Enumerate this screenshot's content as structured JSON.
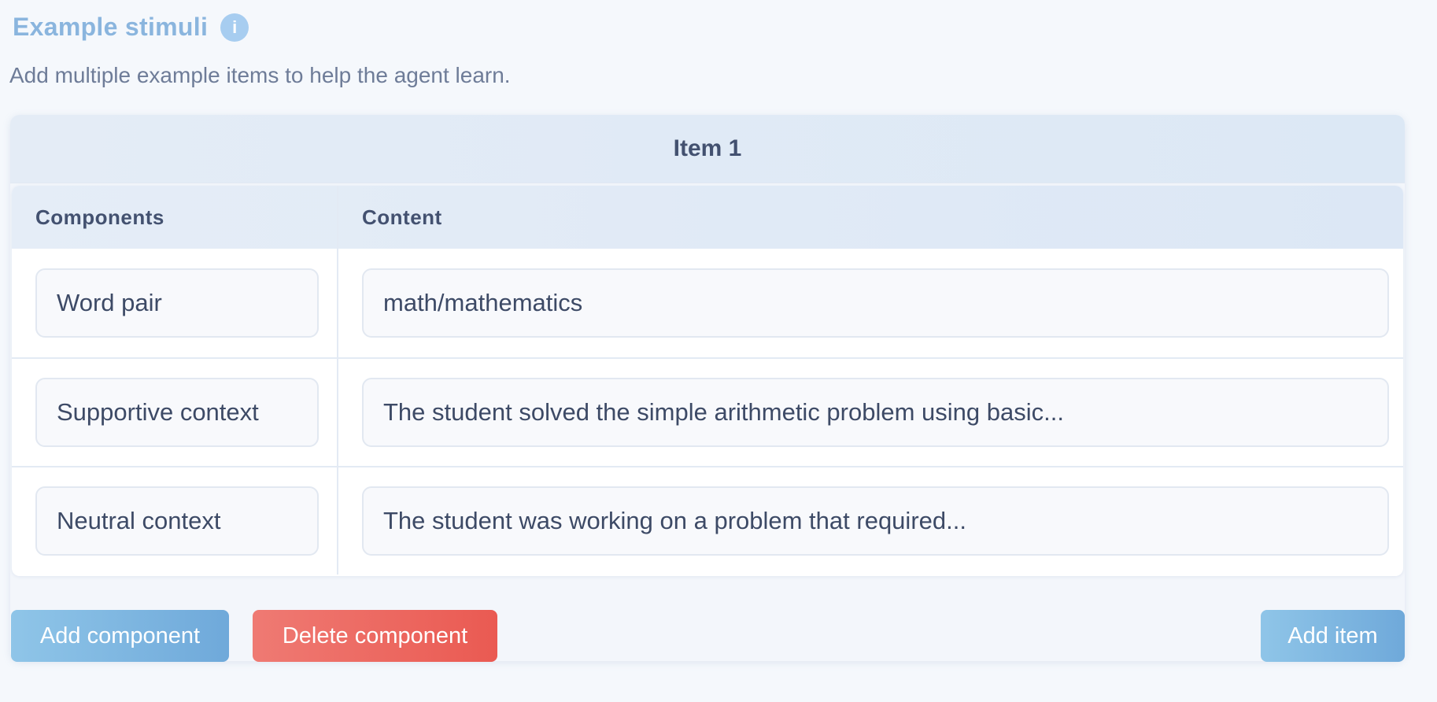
{
  "section": {
    "title": "Example stimuli",
    "info_icon": "i",
    "description": "Add multiple example items to help the agent learn."
  },
  "item": {
    "title": "Item 1",
    "columns": {
      "components": "Components",
      "content": "Content"
    },
    "rows": [
      {
        "component": "Word pair",
        "content": "math/mathematics"
      },
      {
        "component": "Supportive context",
        "content": "The student solved the simple arithmetic problem using basic..."
      },
      {
        "component": "Neutral context",
        "content": "The student was working on a problem that required..."
      }
    ]
  },
  "buttons": {
    "add_component": "Add component",
    "delete_component": "Delete component",
    "add_item": "Add item"
  },
  "colors": {
    "accent_blue": "#6fa9da",
    "danger_red": "#ea5a52",
    "title_blue": "#8ab5de"
  }
}
